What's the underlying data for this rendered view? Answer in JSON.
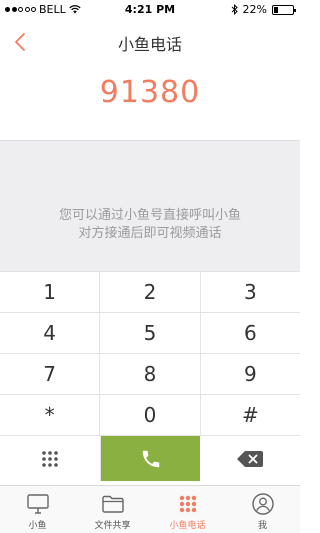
{
  "status_bar": {
    "carrier": "BELL",
    "time": "4:21 PM",
    "battery_text": "22%",
    "battery_level": 0.22,
    "signal_bars_filled": 2
  },
  "nav": {
    "title": "小鱼电话",
    "back_icon": "chevron-left-icon"
  },
  "dialer": {
    "number": "91380",
    "hint_line1": "您可以通过小鱼号直接呼叫小鱼",
    "hint_line2": "对方接通后即可视频通话"
  },
  "keypad": {
    "rows": [
      [
        "1",
        "2",
        "3"
      ],
      [
        "4",
        "5",
        "6"
      ],
      [
        "7",
        "8",
        "9"
      ],
      [
        "*",
        "0",
        "#"
      ]
    ],
    "bottom": {
      "left_icon": "dialpad-grid-icon",
      "center_icon": "phone-call-icon",
      "right_icon": "backspace-icon"
    }
  },
  "tabs": [
    {
      "label": "小鱼",
      "icon": "monitor-icon",
      "active": false
    },
    {
      "label": "文件共享",
      "icon": "folder-icon",
      "active": false
    },
    {
      "label": "小鱼电话",
      "icon": "dialpad-grid-icon",
      "active": true
    },
    {
      "label": "我",
      "icon": "user-icon",
      "active": false
    }
  ],
  "colors": {
    "accent": "#f07d5f",
    "call_green": "#8ab041",
    "hint_background": "#eeeef0"
  }
}
